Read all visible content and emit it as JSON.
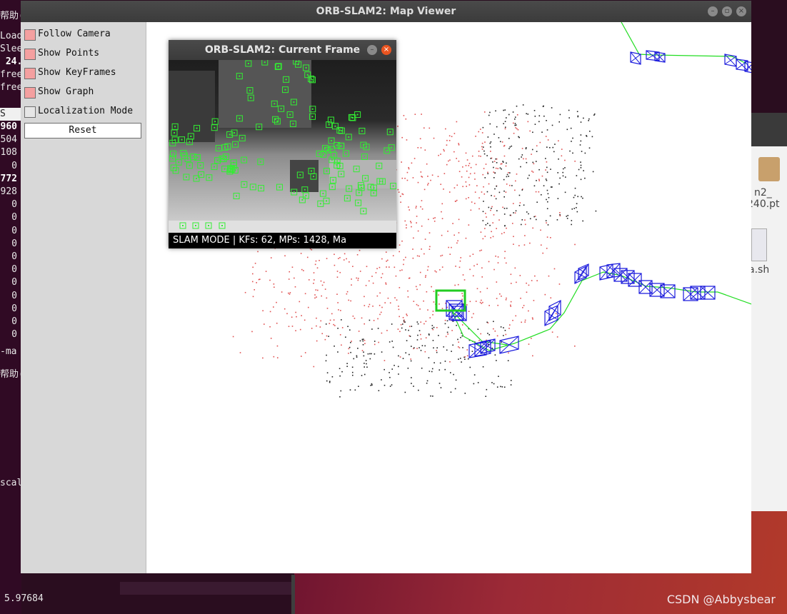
{
  "terminal": {
    "lines": [
      {
        "text": "帮助(H",
        "bold": false
      },
      {
        "text": "Load",
        "bold": false
      },
      {
        "text": "Sleep",
        "bold": false
      },
      {
        "text": " 24.",
        "bold": true
      },
      {
        "text": "free",
        "bold": false
      },
      {
        "text": "free",
        "bold": false
      }
    ],
    "selected_text": "S",
    "numbers": [
      {
        "text": "960",
        "bold": true
      },
      {
        "text": "504",
        "bold": false
      },
      {
        "text": "108",
        "bold": false
      },
      {
        "text": "0",
        "bold": false
      },
      {
        "text": "772",
        "bold": true
      },
      {
        "text": "928",
        "bold": false
      },
      {
        "text": "0",
        "bold": false
      },
      {
        "text": "0",
        "bold": false
      },
      {
        "text": "0",
        "bold": false
      },
      {
        "text": "0",
        "bold": false
      },
      {
        "text": "0",
        "bold": false
      },
      {
        "text": "0",
        "bold": false
      },
      {
        "text": "0",
        "bold": false
      },
      {
        "text": "0",
        "bold": false
      },
      {
        "text": "0",
        "bold": false
      },
      {
        "text": "0",
        "bold": false
      },
      {
        "text": "0",
        "bold": false
      }
    ],
    "tab_fragment": "-ma",
    "menu_fragment": "帮助(H",
    "scale_fragment": "scal",
    "bottom_value": "5.97684"
  },
  "watermark": "CSDN @Abbysbear",
  "file_manager": {
    "file1_label_a": "n2_",
    "file1_label_b": "240.pt",
    "file2_label": "a.sh"
  },
  "map_viewer": {
    "title": "ORB-SLAM2: Map Viewer",
    "menu": {
      "follow_camera": "Follow Camera",
      "show_points": "Show Points",
      "show_keyframes": "Show KeyFrames",
      "show_graph": "Show Graph",
      "localization_mode": "Localization Mode",
      "reset": "Reset"
    },
    "checked": {
      "follow_camera": true,
      "show_points": true,
      "show_keyframes": true,
      "show_graph": true,
      "localization_mode": false
    },
    "colors": {
      "keyframe": "#1a1adc",
      "graph": "#22dd22",
      "current_camera": "#22cc22",
      "map_point": "#e05050",
      "ref_point": "#222222"
    }
  },
  "current_frame": {
    "title": "ORB-SLAM2: Current Frame",
    "status": "SLAM MODE |  KFs: 62, MPs: 1428, Ma",
    "feature_color": "#33ee33"
  }
}
